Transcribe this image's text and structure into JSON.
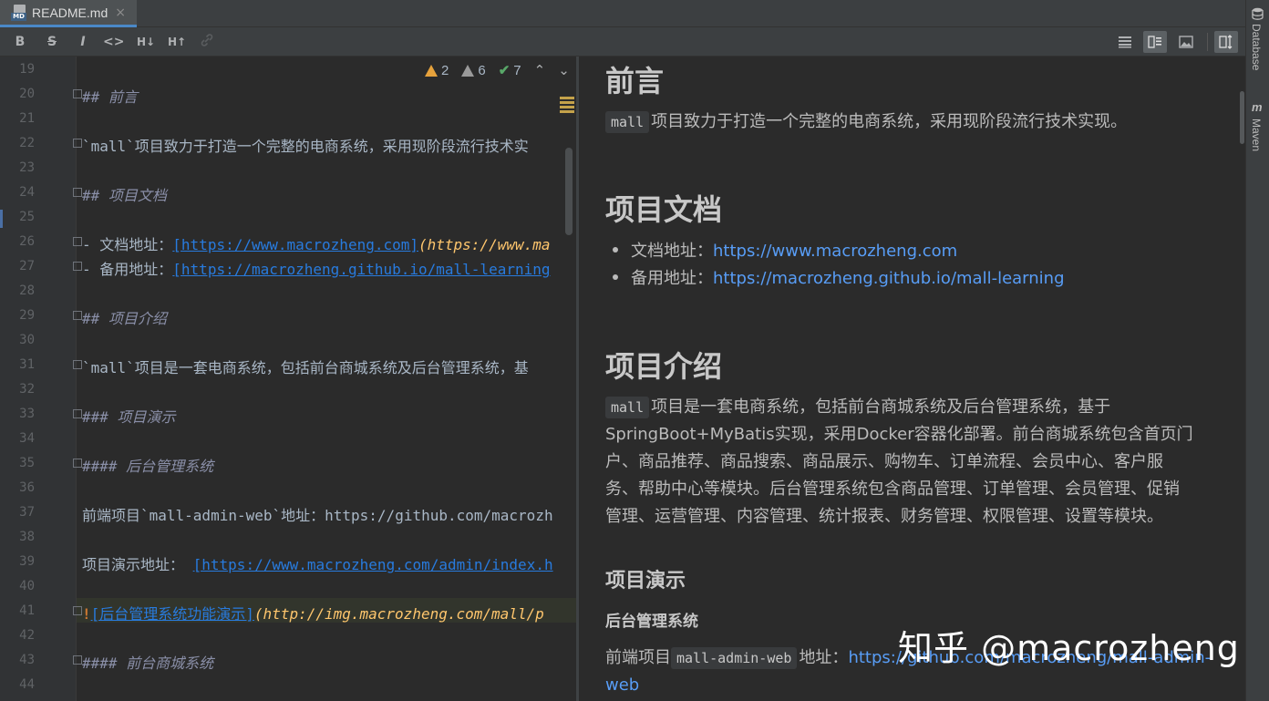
{
  "tab": {
    "label": "README.md",
    "badge": "MD",
    "close": "×"
  },
  "toolbar": {
    "bold": "B",
    "strike": "S",
    "italic": "I",
    "code": "<>",
    "h_down": "H↓",
    "h_up": "H↑"
  },
  "inspection": {
    "errors": "2",
    "warnings": "6",
    "ok": "7"
  },
  "editor": {
    "lines": [
      {
        "n": "19"
      },
      {
        "n": "20"
      },
      {
        "n": "21"
      },
      {
        "n": "22"
      },
      {
        "n": "23"
      },
      {
        "n": "24"
      },
      {
        "n": "25"
      },
      {
        "n": "26"
      },
      {
        "n": "27"
      },
      {
        "n": "28"
      },
      {
        "n": "29"
      },
      {
        "n": "30"
      },
      {
        "n": "31"
      },
      {
        "n": "32"
      },
      {
        "n": "33"
      },
      {
        "n": "34"
      },
      {
        "n": "35"
      },
      {
        "n": "36"
      },
      {
        "n": "37"
      },
      {
        "n": "38"
      },
      {
        "n": "39"
      },
      {
        "n": "40"
      },
      {
        "n": "41"
      },
      {
        "n": "42"
      },
      {
        "n": "43"
      },
      {
        "n": "44"
      }
    ],
    "l20": {
      "mark": "## ",
      "text": "前言"
    },
    "l22": {
      "text": "`mall`项目致力于打造一个完整的电商系统，采用现阶段流行技术实"
    },
    "l24": {
      "mark": "## ",
      "text": "项目文档"
    },
    "l26": {
      "pre": "- 文档地址：",
      "link": "[https://www.macrozheng.com]",
      "url": "(https://www.ma"
    },
    "l27": {
      "pre": "- 备用地址：",
      "link": "[https://macrozheng.github.io/mall-learning"
    },
    "l29": {
      "mark": "## ",
      "text": "项目介绍"
    },
    "l31": {
      "text": "`mall`项目是一套电商系统，包括前台商城系统及后台管理系统，基"
    },
    "l33": {
      "mark": "### ",
      "text": "项目演示"
    },
    "l35": {
      "mark": "#### ",
      "text": "后台管理系统"
    },
    "l37": {
      "text": "前端项目`mall-admin-web`地址：https://github.com/macrozh"
    },
    "l39": {
      "pre": "项目演示地址： ",
      "link": "[https://www.macrozheng.com/admin/index.h"
    },
    "l41": {
      "excl": "!",
      "link": "[后台管理系统功能演示]",
      "url": "(http://img.macrozheng.com/mall/p"
    },
    "l43": {
      "mark": "#### ",
      "text": "前台商城系统"
    }
  },
  "preview": {
    "h_foreword": "前言",
    "foreword_code": "mall",
    "foreword_text": "项目致力于打造一个完整的电商系统，采用现阶段流行技术实现。",
    "h_docs": "项目文档",
    "doc_label": "文档地址：",
    "doc_link": "https://www.macrozheng.com",
    "backup_label": "备用地址：",
    "backup_link": "https://macrozheng.github.io/mall-learning",
    "h_intro": "项目介绍",
    "intro_code": "mall",
    "intro_line1": "项目是一套电商系统，包括前台商城系统及后台管理系统，基于",
    "intro_line2": "SpringBoot+MyBatis实现，采用Docker容器化部署。前台商城系统包含首页门",
    "intro_line3": "户、商品推荐、商品搜索、商品展示、购物车、订单流程、会员中心、客户服",
    "intro_line4": "务、帮助中心等模块。后台管理系统包含商品管理、订单管理、会员管理、促销",
    "intro_line5": "管理、运营管理、内容管理、统计报表、财务管理、权限管理、设置等模块。",
    "h_demo": "项目演示",
    "h_admin": "后台管理系统",
    "frontend_label": "前端项目",
    "frontend_code": "mall-admin-web",
    "frontend_addr": "地址：",
    "frontend_link1": "https://github.com/macrozheng/mall-admin-",
    "frontend_link2": "web"
  },
  "watermark": "知乎 @macrozheng",
  "side_strip": {
    "database": "Database",
    "maven_icon": "m",
    "maven": "Maven"
  },
  "colors": {
    "accent": "#4a88c7",
    "link": "#589df6",
    "warning": "#e6a23c",
    "ok": "#59a869"
  }
}
